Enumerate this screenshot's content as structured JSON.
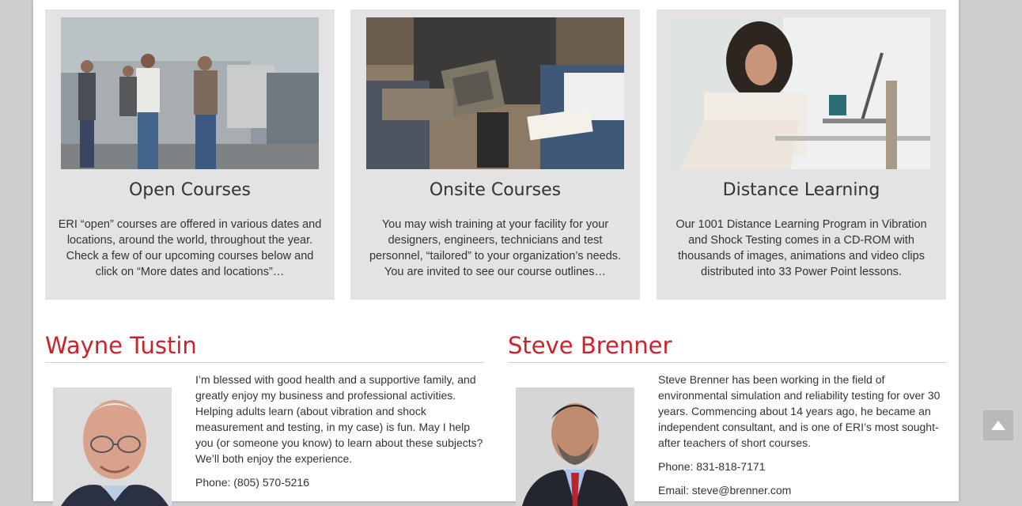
{
  "cards": [
    {
      "title": "Open Courses",
      "text": "ERI “open” courses are offered in various dates and locations, around the world, throughout the year. Check a few of our upcoming courses below and click on “More dates and locations”…"
    },
    {
      "title": "Onsite Courses",
      "text": "You may wish training at your facility for your designers, engineers, technicians and test personnel, “tailored” to your organization’s needs. You are invited to see our course outlines…"
    },
    {
      "title": "Distance Learning",
      "text": "Our 1001 Distance Learning Program in Vibration and Shock Testing comes in a CD-ROM with thousands of images, animations and video clips distributed into 33 Power Point lessons."
    }
  ],
  "people": [
    {
      "name": "Wayne Tustin",
      "bio": "I’m blessed with good health and a supportive family, and greatly enjoy my business and professional activities. Helping adults learn (about vibration and shock measurement and testing, in my case) is fun. May I help you (or someone you know) to learn about these subjects? We’ll both enjoy the experience.",
      "phone": "Phone: (805) 570-5216"
    },
    {
      "name": "Steve Brenner",
      "bio": "Steve Brenner has been working in the field of environmental simulation and reliability testing for over 30 years. Commencing about 14 years ago, he became an independent consultant, and is one of ERI’s most sought-after teachers of short courses.",
      "phone": "Phone: 831-818-7171",
      "email": "Email: steve@brenner.com"
    }
  ],
  "colors": {
    "accent": "#c8242b",
    "card_bg": "#e3e3e3",
    "page_bg": "#cfcfcf"
  },
  "icons": {
    "scroll_top": "arrow-up-icon"
  }
}
